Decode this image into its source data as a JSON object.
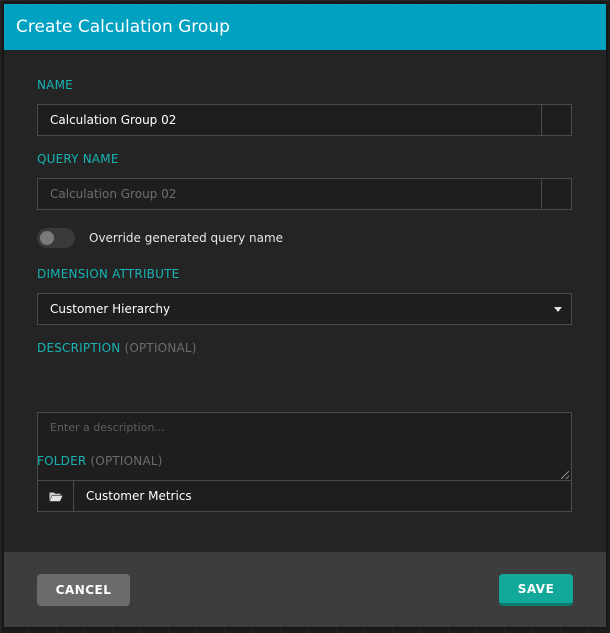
{
  "dialog": {
    "title": "Create Calculation Group"
  },
  "fields": {
    "name": {
      "label": "NAME",
      "value": "Calculation Group 02"
    },
    "query_name": {
      "label": "QUERY NAME",
      "value": "Calculation Group 02"
    },
    "override_toggle": {
      "label": "Override generated query name",
      "state": "off"
    },
    "dimension_attribute": {
      "label": "DIMENSION ATTRIBUTE",
      "selected": "Customer Hierarchy"
    },
    "description": {
      "label": "DESCRIPTION",
      "optional": "(OPTIONAL)",
      "placeholder": "Enter a description..."
    },
    "folder": {
      "label": "FOLDER",
      "optional": "(OPTIONAL)",
      "value": "Customer Metrics"
    }
  },
  "footer": {
    "cancel_label": "CANCEL",
    "save_label": "SAVE"
  },
  "colors": {
    "header": "#00a1c1",
    "label_accent": "#18b3b3",
    "save_button": "#12a99b",
    "cancel_button": "#6b6b6b"
  },
  "icons": {
    "folder": "folder-open-icon",
    "dropdown": "caret-down-icon"
  }
}
